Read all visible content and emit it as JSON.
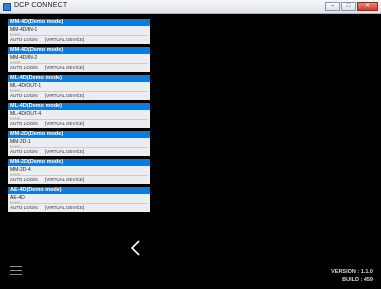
{
  "window": {
    "title": "DCP CONNECT",
    "controls": {
      "minimize": "–",
      "maximize": "□",
      "close": "✕"
    }
  },
  "devices": [
    {
      "name": "MM-4D(Demo mode)",
      "model": "MM-4D/IN-1",
      "sub": "NAME",
      "auto": "AUTO LOGIN",
      "type": "[VIRTUAL DEVICE]"
    },
    {
      "name": "MM-4D(Demo mode)",
      "model": "MM-4D/IN-2",
      "sub": "NAME",
      "auto": "AUTO LOGIN",
      "type": "[VIRTUAL DEVICE]"
    },
    {
      "name": "ML-4D(Demo mode)",
      "model": "ML-4D/OUT-1",
      "sub": "NAME",
      "auto": "AUTO LOGIN",
      "type": "[VIRTUAL DEVICE]"
    },
    {
      "name": "ML-4D(Demo mode)",
      "model": "ML-4D/OUT-4",
      "sub": "NAME",
      "auto": "AUTO LOGIN",
      "type": "[VIRTUAL DEVICE]"
    },
    {
      "name": "MM-2D(Demo mode)",
      "model": "MM-2D-1",
      "sub": "NAME",
      "auto": "AUTO LOGIN",
      "type": "[VIRTUAL DEVICE]"
    },
    {
      "name": "MM-2D(Demo mode)",
      "model": "MM-2D-4",
      "sub": "NAME",
      "auto": "AUTO LOGIN",
      "type": "[VIRTUAL DEVICE]"
    },
    {
      "name": "AE-4D(Demo mode)",
      "model": "AE-4D",
      "sub": "NAME",
      "auto": "AUTO LOGIN",
      "type": "[VIRTUAL DEVICE]"
    }
  ],
  "nav": {
    "back_icon": "chevron-left-icon",
    "menu_icon": "hamburger-menu-icon"
  },
  "footer": {
    "version": "VERSION : 1.1.0",
    "build": "BUILD : 459"
  },
  "colors": {
    "accent": "#0b7de0",
    "background": "#000000",
    "card": "#ecedf0"
  }
}
